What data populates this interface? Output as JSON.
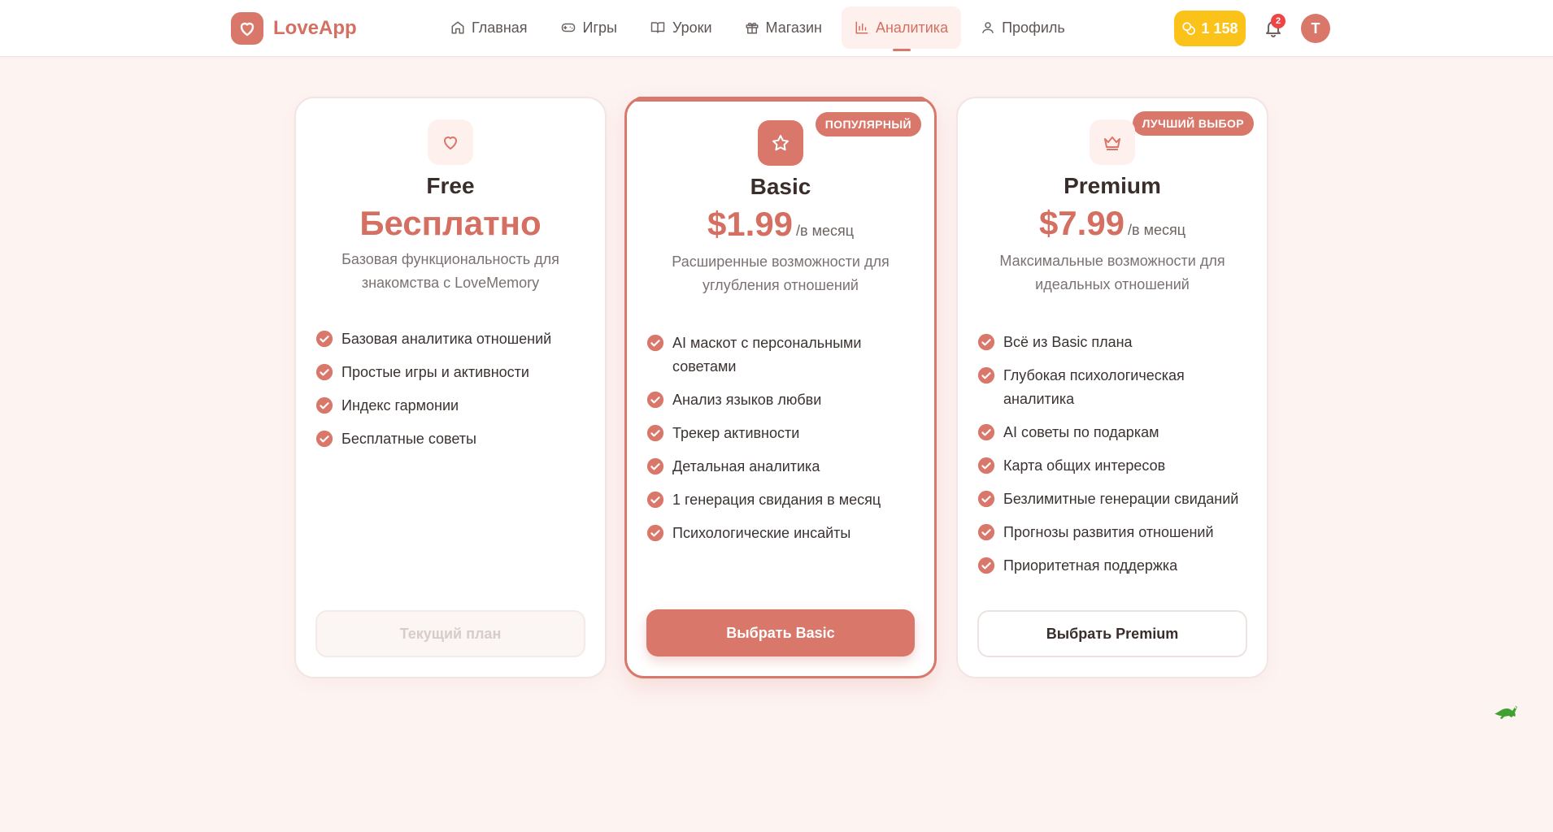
{
  "app": {
    "name": "LoveApp"
  },
  "nav": {
    "items": [
      {
        "label": "Главная",
        "icon": "home-icon"
      },
      {
        "label": "Игры",
        "icon": "gamepad-icon"
      },
      {
        "label": "Уроки",
        "icon": "book-icon"
      },
      {
        "label": "Магазин",
        "icon": "gift-icon"
      },
      {
        "label": "Аналитика",
        "icon": "chart-icon",
        "active": true
      },
      {
        "label": "Профиль",
        "icon": "user-icon"
      }
    ]
  },
  "header": {
    "coins": "1 158",
    "notifications_count": "2",
    "avatar_initial": "T"
  },
  "plans": [
    {
      "name": "Free",
      "price": "Бесплатно",
      "period": "",
      "description": "Базовая функциональность для знакомства с LoveMemory",
      "features": [
        "Базовая аналитика отношений",
        "Простые игры и активности",
        "Индекс гармонии",
        "Бесплатные советы"
      ],
      "cta": "Текущий план",
      "icon": "heart-icon"
    },
    {
      "name": "Basic",
      "price": "$1.99",
      "period": "/в месяц",
      "badge": "ПОПУЛЯРНЫЙ",
      "description": "Расширенные возможности для углубления отношений",
      "features": [
        "AI маскот с персональными советами",
        "Анализ языков любви",
        "Трекер активности",
        "Детальная аналитика",
        "1 генерация свидания в месяц",
        "Психологические инсайты"
      ],
      "cta": "Выбрать Basic",
      "icon": "star-icon"
    },
    {
      "name": "Premium",
      "price": "$7.99",
      "period": "/в месяц",
      "badge": "ЛУЧШИЙ ВЫБОР",
      "description": "Максимальные возможности для идеальных отношений",
      "features": [
        "Всё из Basic плана",
        "Глубокая психологическая аналитика",
        "AI советы по подаркам",
        "Карта общих интересов",
        "Безлимитные генерации свиданий",
        "Прогнозы развития отношений",
        "Приоритетная поддержка"
      ],
      "cta": "Выбрать Premium",
      "icon": "crown-icon"
    }
  ],
  "colors": {
    "accent": "#d9776a",
    "background": "#fdf3f1",
    "coins": "#fbc21a",
    "notification": "#ef4444"
  }
}
